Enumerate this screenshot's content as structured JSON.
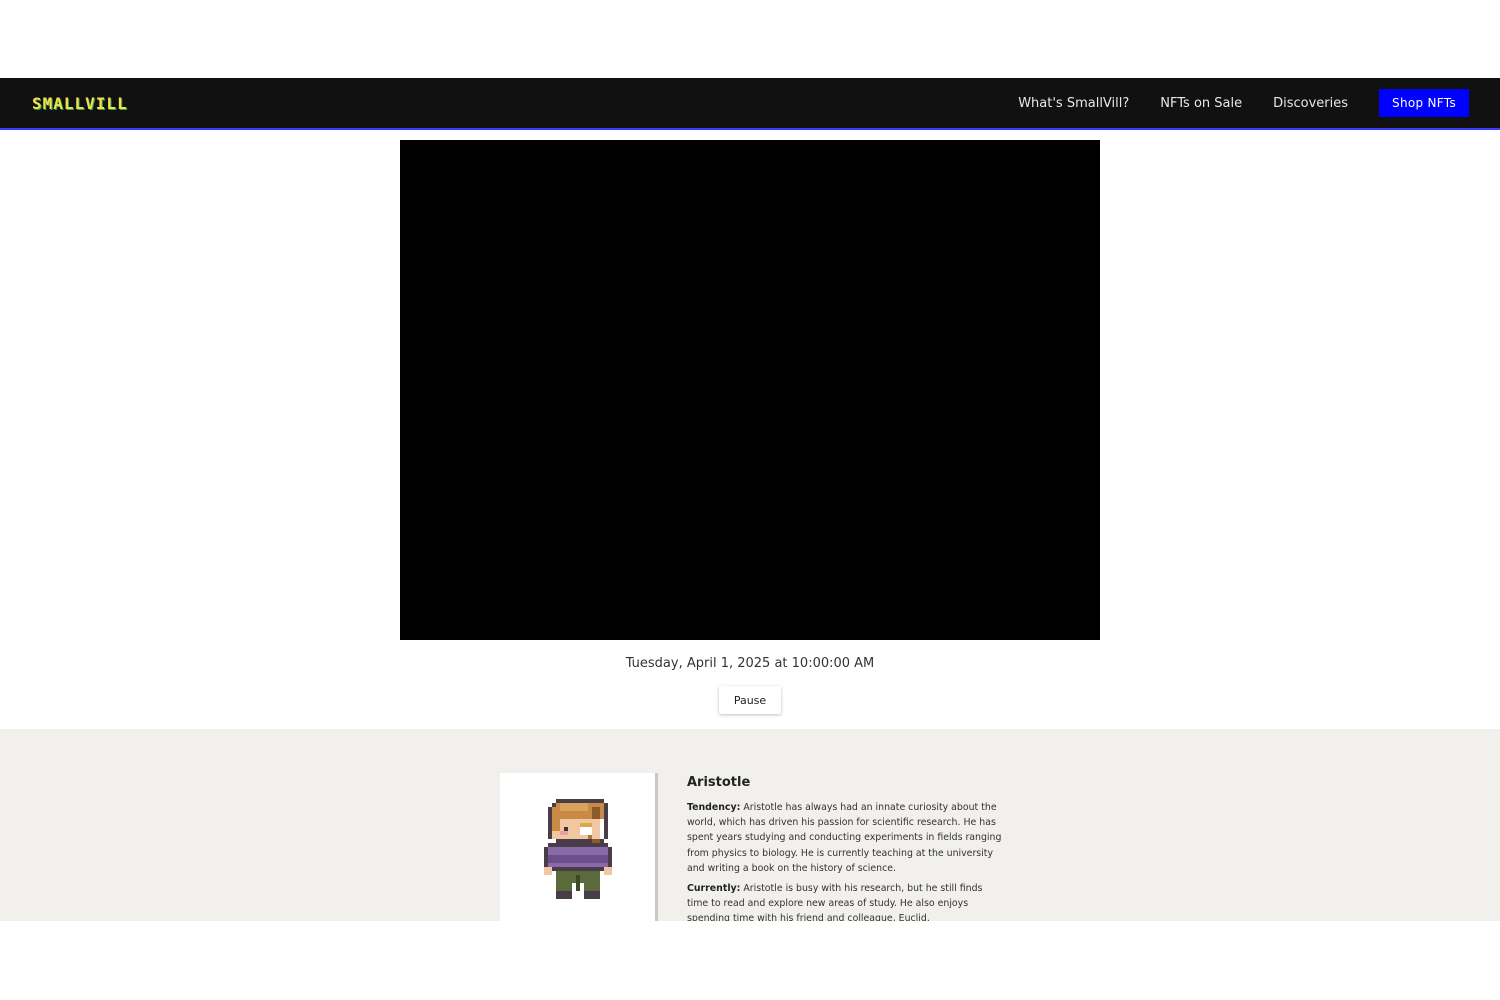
{
  "navbar": {
    "logo_text": "SMALLVILL",
    "links": [
      {
        "label": "What's SmallVill?"
      },
      {
        "label": "NFTs on Sale"
      },
      {
        "label": "Discoveries"
      }
    ],
    "cta_label": "Shop NFTs",
    "cta_color": "#0000ff"
  },
  "simulation": {
    "datetime": "Tuesday, April 1, 2025 at 10:00:00 AM",
    "pause_label": "Pause"
  },
  "persona": {
    "name": "Aristotle",
    "avatar_icon": "pixel-character-sprite",
    "tendency_label": "Tendency:",
    "tendency_text": " Aristotle has always had an innate curiosity about the world, which has driven his passion for scientific research. He has spent years studying and conducting experiments in fields ranging from physics to biology. He is currently teaching at the university and writing a book on the history of science.",
    "currently_label": "Currently:",
    "currently_text": " Aristotle is busy with his research, but he still finds time to read and explore new areas of study. He also enjoys spending time with his friend and colleague, Euclid."
  }
}
